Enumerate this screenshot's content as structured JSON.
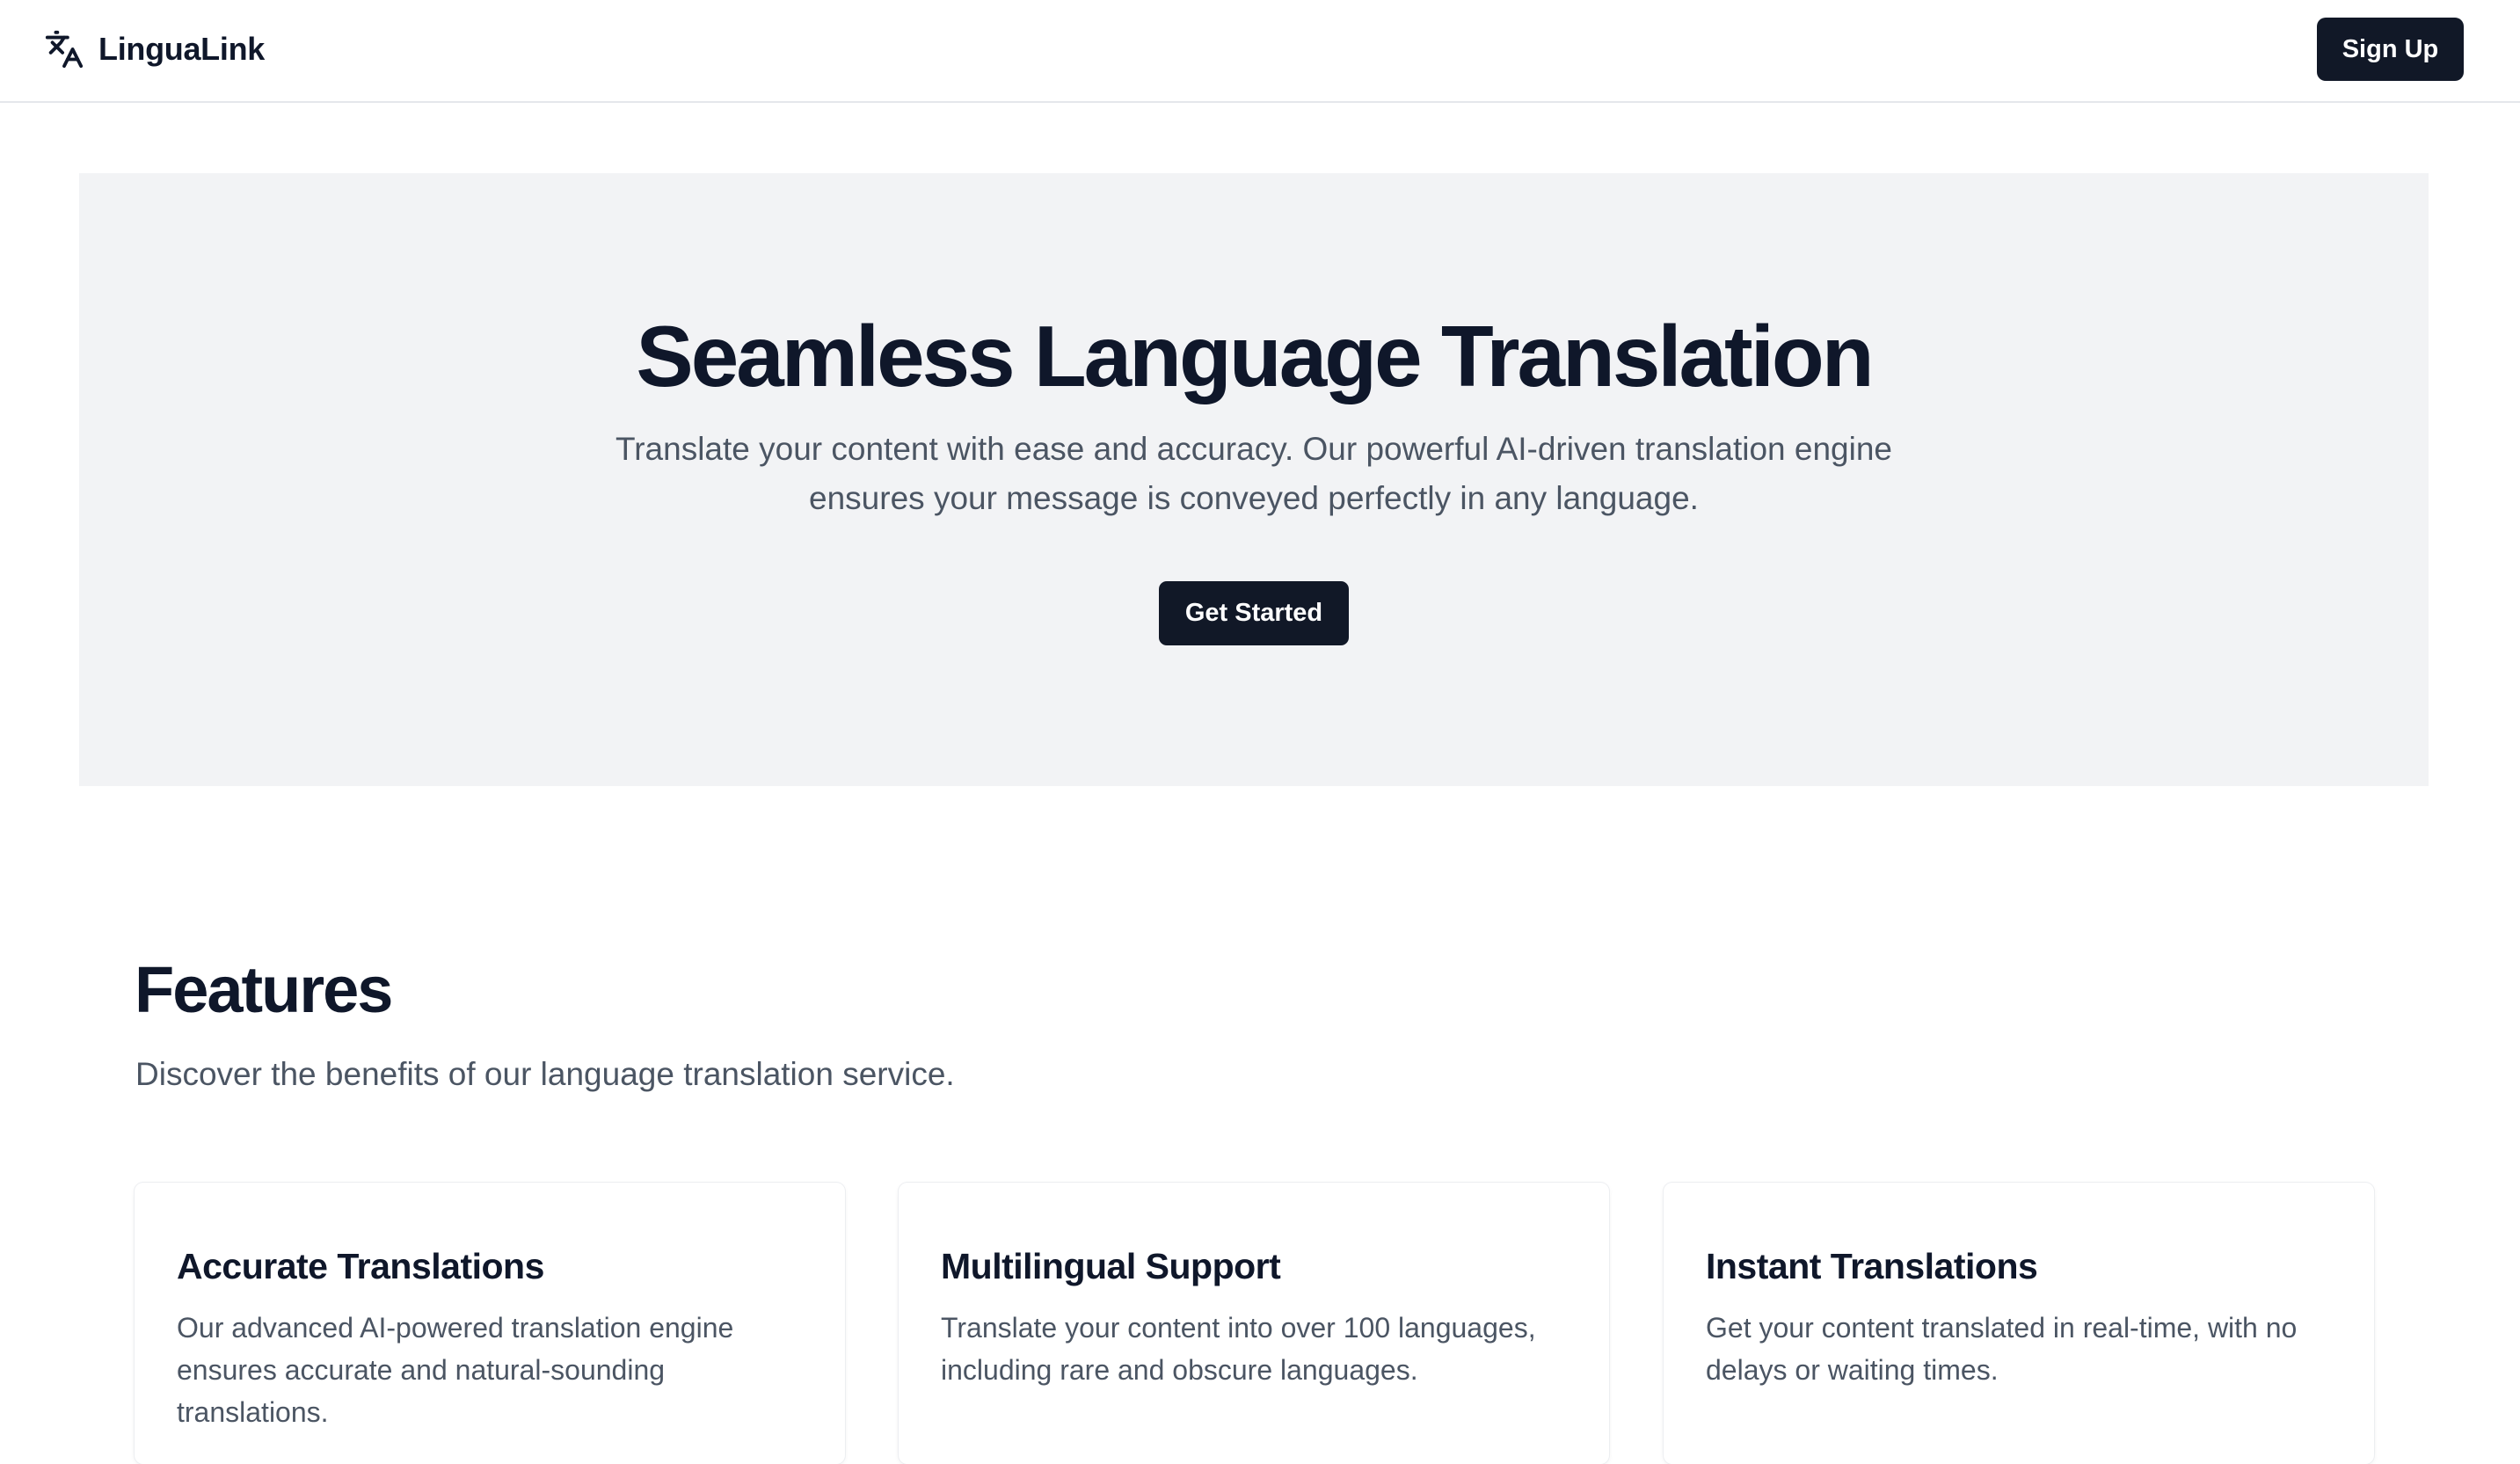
{
  "header": {
    "brand_name": "LinguaLink",
    "brand_icon": "translate-icon",
    "signup_label": "Sign Up"
  },
  "hero": {
    "title": "Seamless Language Translation",
    "subtitle": "Translate your content with ease and accuracy. Our powerful AI-driven translation engine ensures your message is conveyed perfectly in any language.",
    "cta_label": "Get Started"
  },
  "features": {
    "title": "Features",
    "subtitle": "Discover the benefits of our language translation service.",
    "cards": [
      {
        "title": "Accurate Translations",
        "description": "Our advanced AI-powered translation engine ensures accurate and natural-sounding translations."
      },
      {
        "title": "Multilingual Support",
        "description": "Translate your content into over 100 languages, including rare and obscure languages."
      },
      {
        "title": "Instant Translations",
        "description": "Get your content translated in real-time, with no delays or waiting times."
      }
    ]
  },
  "colors": {
    "primary_button": "#111827",
    "hero_background": "#f2f3f5",
    "heading_text": "#0f172a",
    "body_text": "#4b5563"
  }
}
